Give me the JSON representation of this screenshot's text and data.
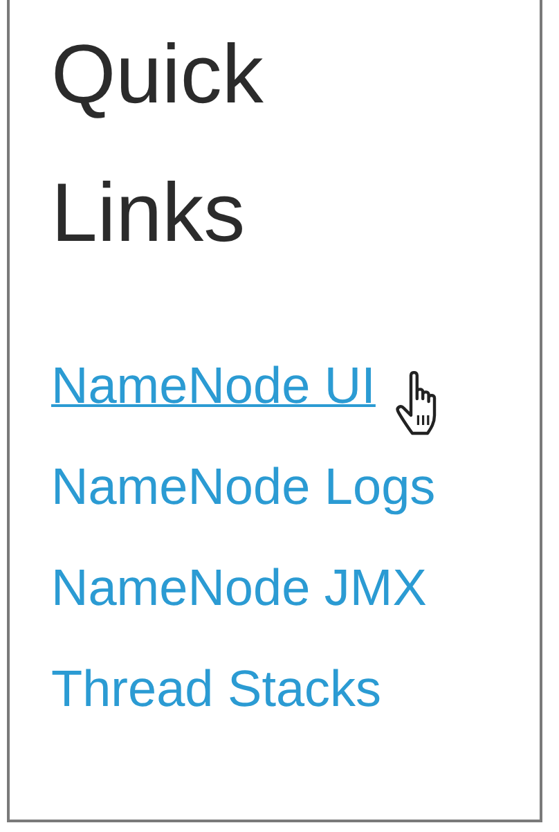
{
  "panel": {
    "title": "Quick Links",
    "links": [
      {
        "label": "NameNode UI",
        "hovered": true
      },
      {
        "label": "NameNode Logs",
        "hovered": false
      },
      {
        "label": "NameNode JMX",
        "hovered": false
      },
      {
        "label": "Thread Stacks",
        "hovered": false
      }
    ]
  }
}
